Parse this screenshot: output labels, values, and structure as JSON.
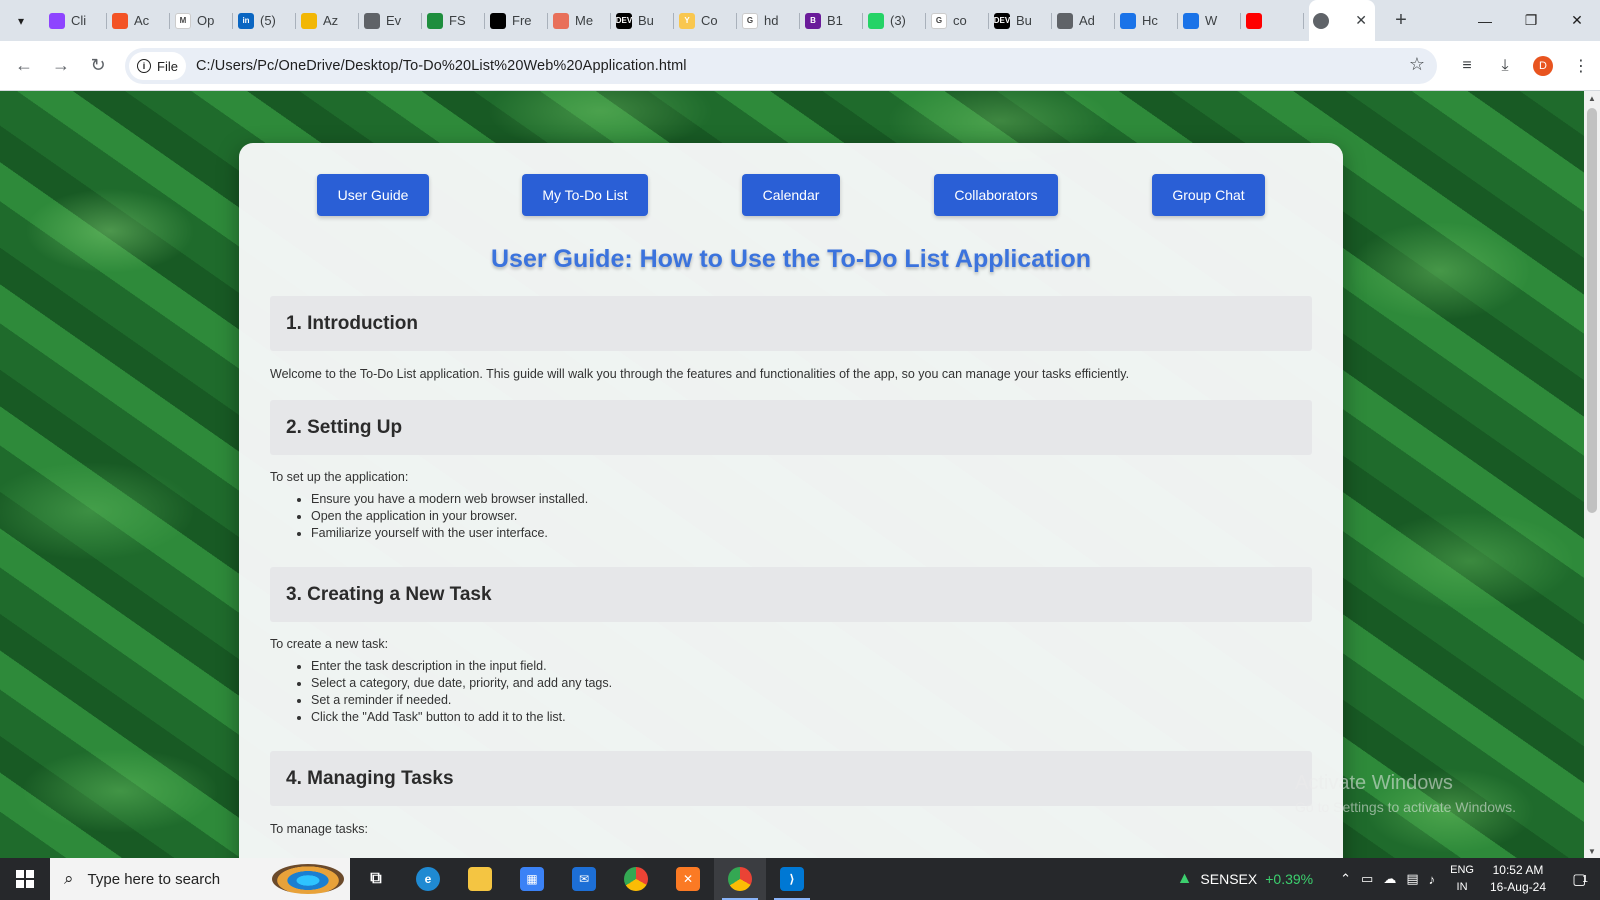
{
  "browser": {
    "tabs": [
      {
        "label": "Cli",
        "color": "#8e44ff",
        "glyph": ""
      },
      {
        "label": "Ac",
        "color": "#f35325",
        "glyph": ""
      },
      {
        "label": "Op",
        "color": "#ffffff",
        "glyph": "M"
      },
      {
        "label": "(5)",
        "color": "#0a66c2",
        "glyph": "in"
      },
      {
        "label": "Az",
        "color": "#f2b705",
        "glyph": ""
      },
      {
        "label": "Ev",
        "color": "#5f6368",
        "glyph": ""
      },
      {
        "label": "FS",
        "color": "#1e8e3e",
        "glyph": ""
      },
      {
        "label": "Fre",
        "color": "#000000",
        "glyph": ""
      },
      {
        "label": "Me",
        "color": "#e8705a",
        "glyph": ""
      },
      {
        "label": "Bu",
        "color": "#000000",
        "glyph": "DEV"
      },
      {
        "label": "Co",
        "color": "#f9c74f",
        "glyph": "Y"
      },
      {
        "label": "hd",
        "color": "#ffffff",
        "glyph": "G"
      },
      {
        "label": "B1",
        "color": "#6a1b9a",
        "glyph": "B"
      },
      {
        "label": "(3)",
        "color": "#25d366",
        "glyph": ""
      },
      {
        "label": "co",
        "color": "#ffffff",
        "glyph": "G"
      },
      {
        "label": "Bu",
        "color": "#000000",
        "glyph": "DEV"
      },
      {
        "label": "Ad",
        "color": "#5f6368",
        "glyph": ""
      },
      {
        "label": "Hc",
        "color": "#1a73e8",
        "glyph": ""
      },
      {
        "label": "W",
        "color": "#1a73e8",
        "glyph": ""
      },
      {
        "label": "",
        "color": "#ff0000",
        "glyph": ""
      }
    ],
    "active_tab_close": "✕",
    "new_tab": "+",
    "window_controls": {
      "minimize": "—",
      "restore": "❐",
      "close": "✕"
    },
    "site_chip_label": "File",
    "url": "C:/Users/Pc/OneDrive/Desktop/To-Do%20List%20Web%20Application.html",
    "profile_initial": "D"
  },
  "app": {
    "nav_buttons": [
      "User Guide",
      "My To-Do List",
      "Calendar",
      "Collaborators",
      "Group Chat"
    ],
    "title": "User Guide: How to Use the To-Do List Application",
    "sections": {
      "intro": {
        "heading": "1. Introduction",
        "text": "Welcome to the To-Do List application. This guide will walk you through the features and functionalities of the app, so you can manage your tasks efficiently."
      },
      "setup": {
        "heading": "2. Setting Up",
        "lead": "To set up the application:",
        "items": [
          "Ensure you have a modern web browser installed.",
          "Open the application in your browser.",
          "Familiarize yourself with the user interface."
        ]
      },
      "create": {
        "heading": "3. Creating a New Task",
        "lead": "To create a new task:",
        "items": [
          "Enter the task description in the input field.",
          "Select a category, due date, priority, and add any tags.",
          "Set a reminder if needed.",
          "Click the \"Add Task\" button to add it to the list."
        ]
      },
      "manage": {
        "heading": "4. Managing Tasks",
        "lead": "To manage tasks:"
      }
    },
    "colors": {
      "accent": "#2a5fd6",
      "title": "#3b73dd",
      "section_bg": "#e6e7e9"
    }
  },
  "watermark": {
    "title": "Activate Windows",
    "subtitle": "Go to Settings to activate Windows."
  },
  "taskbar": {
    "search_placeholder": "Type here to search",
    "sensex_label": "SENSEX",
    "sensex_change": "+0.39%",
    "lang_line1": "ENG",
    "lang_line2": "IN",
    "time": "10:52 AM",
    "date": "16-Aug-24",
    "notification_count": "1"
  }
}
